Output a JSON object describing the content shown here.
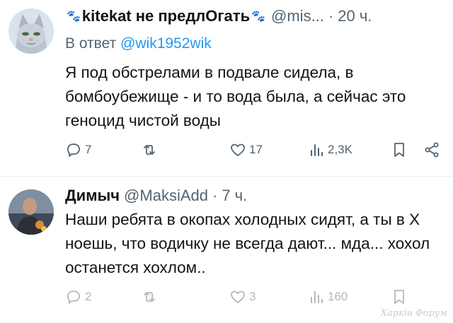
{
  "tweets": [
    {
      "display_name": "kitekat не предлОгать",
      "decor_left": "🐾",
      "decor_right": "🐾",
      "handle": "@mis...",
      "sep": "·",
      "time": "20 ч.",
      "reply_prefix": "В ответ",
      "reply_to": "@wik1952wik",
      "text": "Я под обстрелами в подвале сидела, в бомбоубежище - и то вода была, а сейчас это геноцид чистой воды",
      "actions": {
        "replies": "7",
        "retweets": "",
        "likes": "17",
        "views": "2,3K"
      }
    },
    {
      "display_name": "Димыч",
      "handle": "@MaksiAdd",
      "sep": "·",
      "time": "7 ч.",
      "text": "Наши ребята в окопах холодных сидят, а ты в Х ноешь, что водичку не всегда дают... мда... хохол останется хохлом..",
      "actions": {
        "replies": "2",
        "retweets": "",
        "likes": "3",
        "views": "160"
      }
    }
  ],
  "watermark": "Харків Форум",
  "icons": [
    "reply-icon",
    "retweet-icon",
    "like-icon",
    "views-icon",
    "bookmark-icon",
    "share-icon"
  ]
}
